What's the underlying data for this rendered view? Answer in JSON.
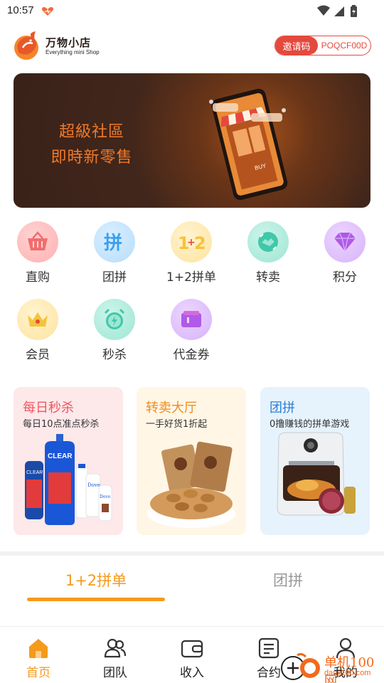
{
  "status_bar": {
    "time": "10:57"
  },
  "header": {
    "logo_title": "万物小店",
    "logo_subtitle": "Everything mini Shop",
    "invite_label": "邀请码",
    "invite_code": "POQCF00D"
  },
  "banner": {
    "line1": "超級社區",
    "line2": "即時新零售",
    "phone_sign": "BUY"
  },
  "grid": {
    "items": [
      {
        "label": "直购",
        "icon": "shopping-basket-icon",
        "color": "#f26d6d"
      },
      {
        "label": "团拼",
        "icon": "pin-icon",
        "color": "#3aa0f0"
      },
      {
        "label": "1+2拼单",
        "icon": "one-plus-two-icon",
        "color": "#f7c23c"
      },
      {
        "label": "转卖",
        "icon": "handshake-icon",
        "color": "#3fc9a8"
      },
      {
        "label": "积分",
        "icon": "diamond-icon",
        "color": "#b05ae8"
      },
      {
        "label": "会员",
        "icon": "crown-icon",
        "color": "#f6c43a"
      },
      {
        "label": "秒杀",
        "icon": "alarm-clock-icon",
        "color": "#3fc9a8"
      },
      {
        "label": "代金券",
        "icon": "voucher-icon",
        "color": "#b05ae8"
      }
    ]
  },
  "cards": [
    {
      "title": "每日秒杀",
      "subtitle": "每日10点准点秒杀",
      "title_color": "#f0565c",
      "bg": "#fde8ea",
      "product_texts": [
        "CLEAR",
        "CLEAR",
        "Dove",
        "Dove"
      ]
    },
    {
      "title": "转卖大厅",
      "subtitle": "一手好货1折起",
      "title_color": "#f08a1c",
      "bg": "#fff6e6"
    },
    {
      "title": "团拼",
      "subtitle": "0撸赚钱的拼单游戏",
      "title_color": "#2a7fd8",
      "bg": "#e6f3fd"
    }
  ],
  "tabs": [
    {
      "label": "1+2拼单",
      "active": true
    },
    {
      "label": "团拼",
      "active": false
    }
  ],
  "bottom_nav": [
    {
      "label": "首页",
      "icon": "home-icon",
      "active": true
    },
    {
      "label": "团队",
      "icon": "team-icon",
      "active": false
    },
    {
      "label": "收入",
      "icon": "wallet-icon",
      "active": false
    },
    {
      "label": "合约",
      "icon": "contract-icon",
      "active": false
    },
    {
      "label": "我的",
      "icon": "profile-icon",
      "active": false
    }
  ],
  "watermark": {
    "text1": "单机100网",
    "text2": "danji100.com"
  },
  "colors": {
    "accent": "#f59a1b",
    "invite_red": "#e4493d",
    "inactive_tab": "#999999"
  }
}
